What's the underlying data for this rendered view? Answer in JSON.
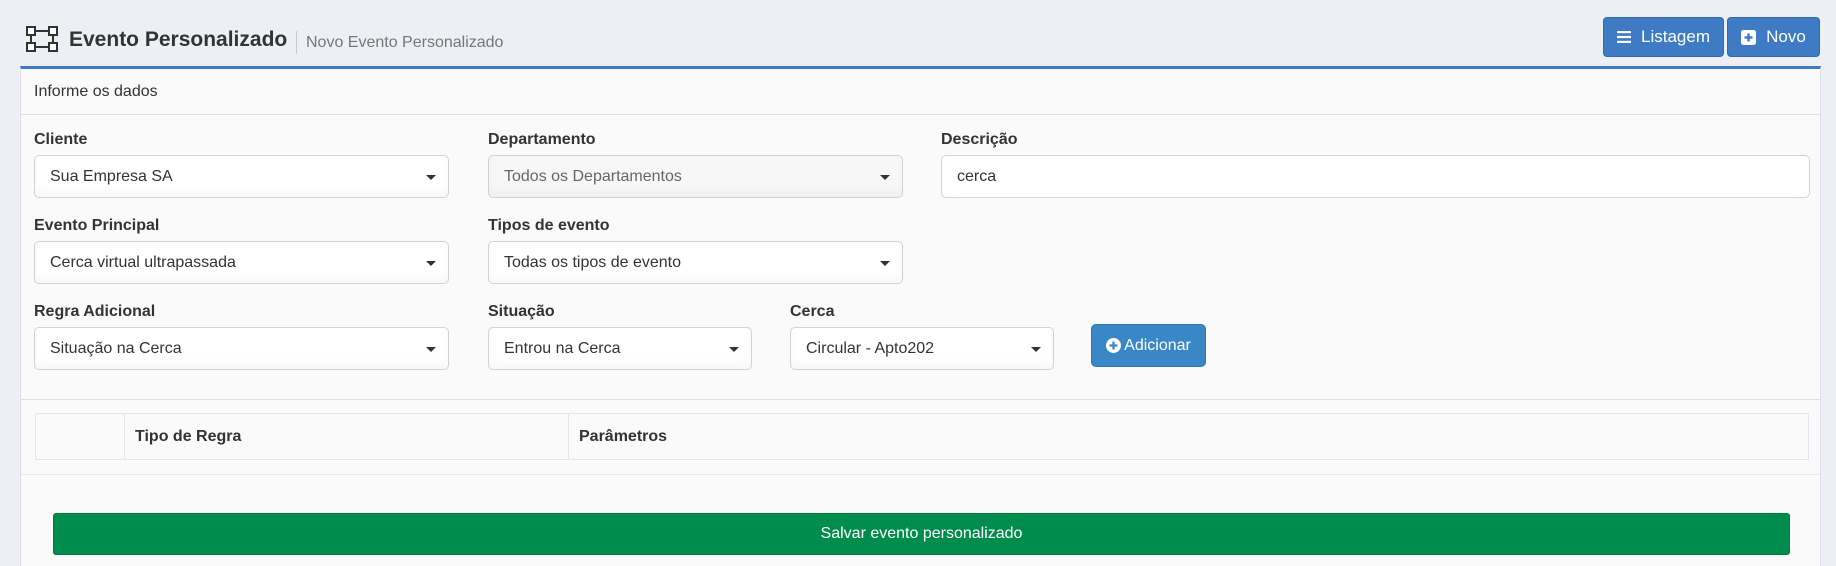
{
  "header": {
    "title": "Evento Personalizado",
    "subtitle": "Novo Evento Personalizado",
    "icon": "vector-square-icon",
    "buttons": {
      "listagem": "Listagem",
      "novo": "Novo"
    }
  },
  "card": {
    "heading": "Informe os dados"
  },
  "form": {
    "cliente": {
      "label": "Cliente",
      "value": "Sua Empresa SA"
    },
    "departamento": {
      "label": "Departamento",
      "value": "Todos os Departamentos"
    },
    "descricao": {
      "label": "Descrição",
      "value": "cerca"
    },
    "evento_principal": {
      "label": "Evento Principal",
      "value": "Cerca virtual ultrapassada"
    },
    "tipos_evento": {
      "label": "Tipos de evento",
      "value": "Todas os tipos de evento"
    },
    "regra_adicional": {
      "label": "Regra Adicional",
      "value": "Situação na Cerca"
    },
    "situacao": {
      "label": "Situação",
      "value": "Entrou na Cerca"
    },
    "cerca": {
      "label": "Cerca",
      "value": "Circular - Apto202"
    },
    "adicionar": "Adicionar"
  },
  "rules_table": {
    "columns": [
      "",
      "Tipo de Regra",
      "Parâmetros"
    ],
    "rows": []
  },
  "footer": {
    "save": "Salvar evento personalizado"
  },
  "colors": {
    "primary": "#3f7bc4",
    "add_button": "#3a87c8",
    "save_button": "#008c4c"
  }
}
